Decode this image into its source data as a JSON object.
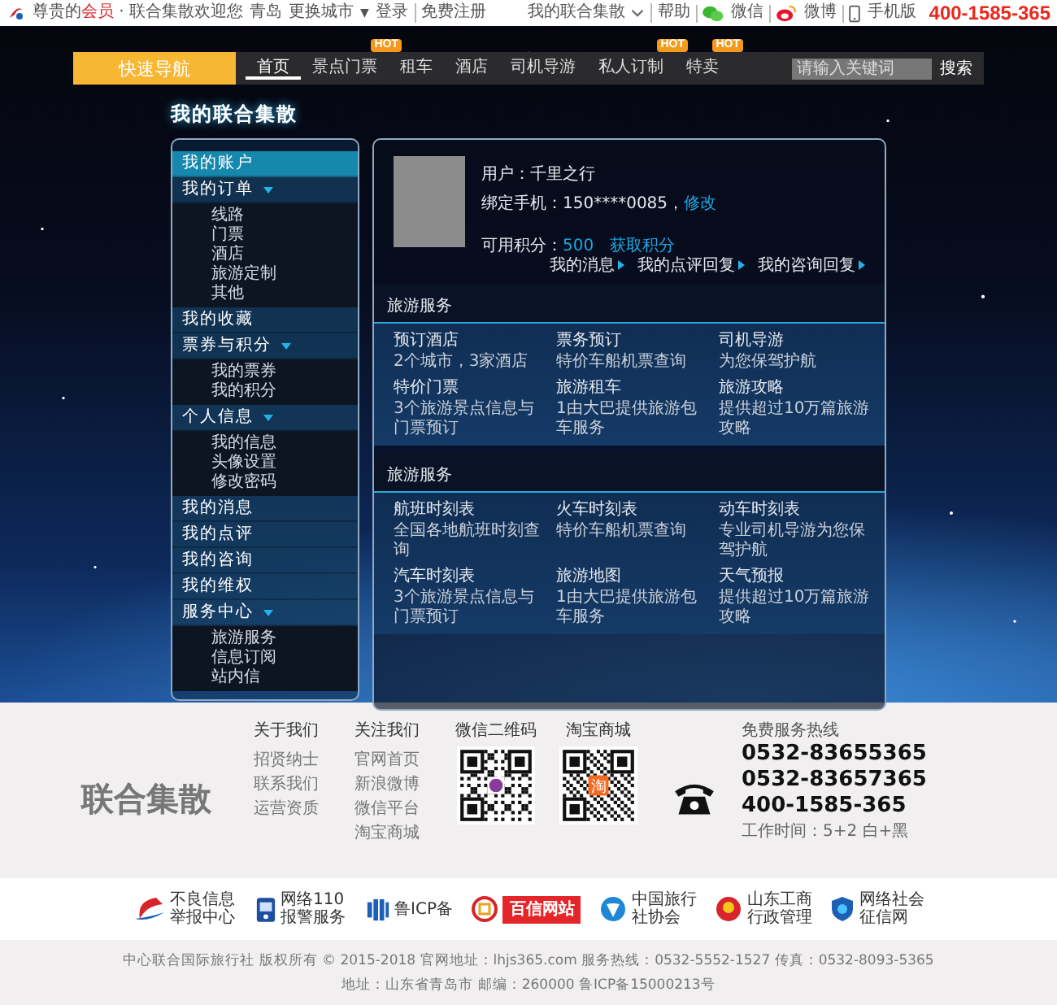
{
  "top_bar": {
    "greeting": [
      {
        "text": "尊贵的",
        "highlight": false
      },
      {
        "text": "会员",
        "highlight": true
      },
      {
        "text": " · 联合集散欢迎您",
        "highlight": false
      }
    ],
    "city": "青岛",
    "change_city": "更换城市",
    "change_city_caret": "▼",
    "login": "登录",
    "register": "免费注册",
    "account": "我的联合集散",
    "help": "帮助",
    "wechat": "微信",
    "weibo": "微博",
    "mobile": "手机版",
    "hotline": "400-1585-365"
  },
  "nav": {
    "quick_nav": "快速导航",
    "items": [
      {
        "label": "首页",
        "selected": true
      },
      {
        "label": "景点门票",
        "selected": false,
        "badge": "HOT"
      },
      {
        "label": "租车",
        "selected": false
      },
      {
        "label": "酒店",
        "selected": false
      },
      {
        "label": "司机导游",
        "selected": false
      },
      {
        "label": "私人订制",
        "selected": false,
        "badge": "HOT"
      },
      {
        "label": "特卖",
        "selected": false,
        "badge": "HOT"
      }
    ],
    "search": {
      "placeholder": "请输入关键词",
      "button": "搜索"
    }
  },
  "page_title": "我的联合集散",
  "sidebar": {
    "items": [
      {
        "label": "我的账户",
        "selected": true,
        "expanded": false
      },
      {
        "label": "我的订单",
        "selected": false,
        "expanded": true,
        "children": [
          {
            "label": "线路"
          },
          {
            "label": "门票"
          },
          {
            "label": "酒店"
          },
          {
            "label": "旅游定制"
          },
          {
            "label": "其他"
          }
        ]
      },
      {
        "label": "我的收藏",
        "selected": false,
        "expanded": false
      },
      {
        "label": "票券与积分",
        "selected": false,
        "expanded": true,
        "children": [
          {
            "label": "我的票券"
          },
          {
            "label": "我的积分"
          }
        ]
      },
      {
        "label": "个人信息",
        "selected": false,
        "expanded": true,
        "children": [
          {
            "label": "我的信息"
          },
          {
            "label": "头像设置"
          },
          {
            "label": "修改密码"
          }
        ]
      },
      {
        "label": "我的消息",
        "selected": false,
        "expanded": false
      },
      {
        "label": "我的点评",
        "selected": false,
        "expanded": false
      },
      {
        "label": "我的咨询",
        "selected": false,
        "expanded": false
      },
      {
        "label": "我的维权",
        "selected": false,
        "expanded": false
      },
      {
        "label": "服务中心",
        "selected": false,
        "expanded": true,
        "children": [
          {
            "label": "旅游服务"
          },
          {
            "label": "信息订阅"
          },
          {
            "label": "站内信"
          }
        ]
      }
    ]
  },
  "profile": {
    "user": "用户：千里之行",
    "phone": "绑定手机：150****0085，",
    "phone_link": "修改",
    "points_label": "可用积分：",
    "points": "500",
    "points_link": "获取积分",
    "quick_links": [
      "我的消息",
      "我的点评回复",
      "我的咨询回复"
    ]
  },
  "sections": [
    {
      "title": "旅游服务",
      "cards": [
        {
          "title": "预订酒店",
          "desc": "2个城市，3家酒店"
        },
        {
          "title": "票务预订",
          "desc": "特价车船机票查询"
        },
        {
          "title": "司机导游",
          "desc": "为您保驾护航"
        },
        {
          "title": "特价门票",
          "desc": "3个旅游景点信息与门票预订"
        },
        {
          "title": "旅游租车",
          "desc": "1由大巴提供旅游包车服务"
        },
        {
          "title": "旅游攻略",
          "desc": "提供超过10万篇旅游攻略"
        }
      ]
    },
    {
      "title": "旅游服务",
      "cards": [
        {
          "title": "航班时刻表",
          "desc": "全国各地航班时刻查询"
        },
        {
          "title": "火车时刻表",
          "desc": "特价车船机票查询"
        },
        {
          "title": "动车时刻表",
          "desc": "专业司机导游为您保驾护航"
        },
        {
          "title": "汽车时刻表",
          "desc": "3个旅游景点信息与门票预订"
        },
        {
          "title": "旅游地图",
          "desc": "1由大巴提供旅游包车服务"
        },
        {
          "title": "天气预报",
          "desc": "提供超过10万篇旅游攻略"
        }
      ]
    }
  ],
  "footer": {
    "brand": "联合集散",
    "columns": [
      {
        "heading": "关于我们",
        "links": [
          "招贤纳士",
          "联系我们",
          "运营资质"
        ]
      },
      {
        "heading": "关注我们",
        "links": [
          "官网首页",
          "新浪微博",
          "微信平台",
          "淘宝商城"
        ]
      }
    ],
    "qr_codes": [
      {
        "label": "微信二维码",
        "kind": "wechat"
      },
      {
        "label": "淘宝商城",
        "kind": "taobao",
        "mark": "淘"
      }
    ],
    "hotline_label": "免费服务热线",
    "numbers": [
      "0532-83655365",
      "0532-83657365",
      "400-1585-365"
    ],
    "hours": "工作时间：5+2  白+黑"
  },
  "badges": [
    {
      "kind": "report",
      "lines": [
        "不良信息",
        "举报中心"
      ]
    },
    {
      "kind": "police",
      "lines": [
        "网络110",
        "报警服务"
      ]
    },
    {
      "kind": "icp",
      "lines": [
        "鲁ICP备"
      ]
    },
    {
      "kind": "trust",
      "lines": [
        "百信网站"
      ]
    },
    {
      "kind": "travel",
      "lines": [
        "中国旅行",
        "社协会"
      ]
    },
    {
      "kind": "commerce",
      "lines": [
        "山东工商",
        "行政管理"
      ]
    },
    {
      "kind": "credit",
      "lines": [
        "网络社会",
        "征信网"
      ]
    }
  ],
  "copyright": [
    "中心联合国际旅行社 版权所有 © 2015-2018 官网地址：lhjs365.com  服务热线：0532-5552-1527  传真：0532-8093-5365",
    "地址：山东省青岛市  邮编：260000 鲁ICP备15000213号"
  ]
}
